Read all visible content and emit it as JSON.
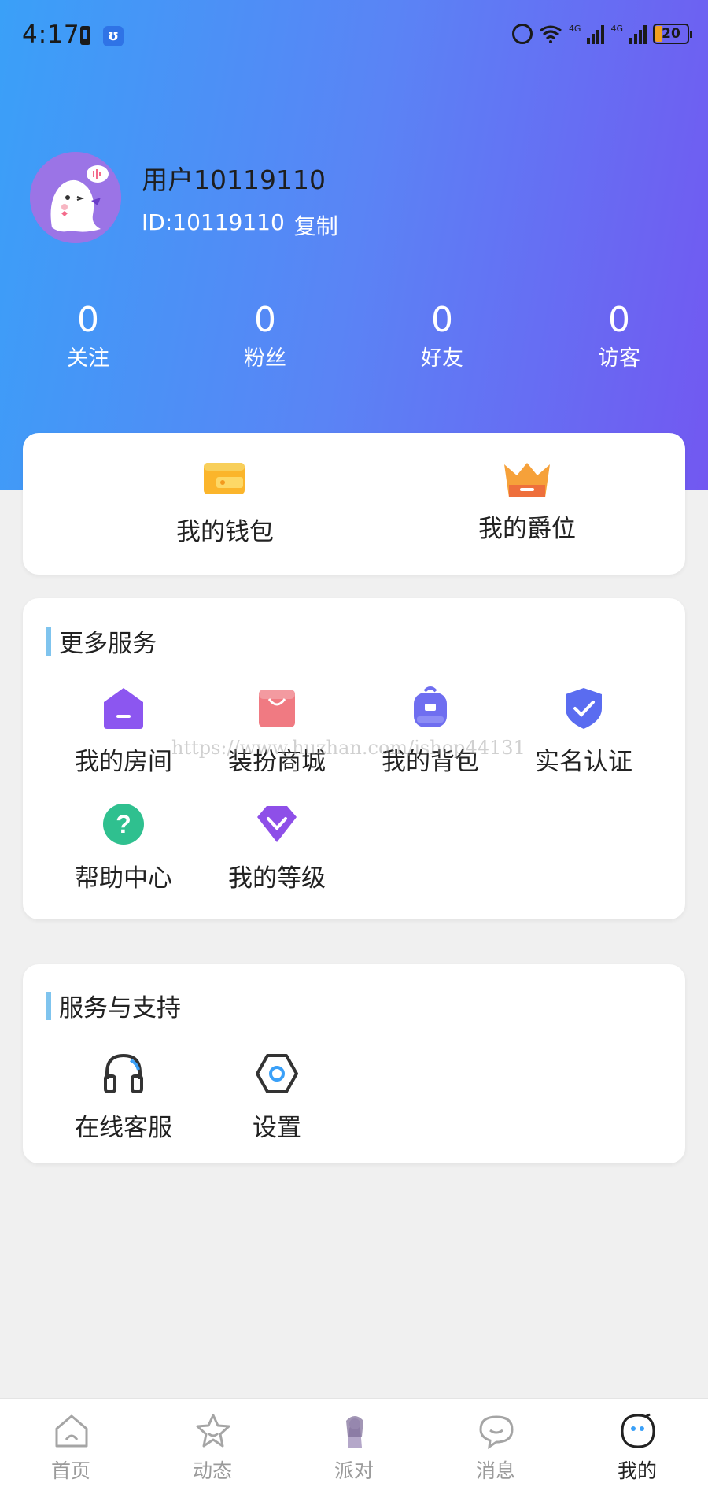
{
  "status_bar": {
    "time": "4:17",
    "battery": "20",
    "network_label": "4G"
  },
  "profile": {
    "username": "用户10119110",
    "id_text": "ID:10119110",
    "copy_label": "复制"
  },
  "stats": [
    {
      "value": "0",
      "label": "关注"
    },
    {
      "value": "0",
      "label": "粉丝"
    },
    {
      "value": "0",
      "label": "好友"
    },
    {
      "value": "0",
      "label": "访客"
    }
  ],
  "quick": {
    "wallet": "我的钱包",
    "rank": "我的爵位"
  },
  "more_services": {
    "title": "更多服务",
    "items": [
      {
        "label": "我的房间",
        "icon": "house-icon",
        "color": "#8c56f0"
      },
      {
        "label": "装扮商城",
        "icon": "shopping-bag-icon",
        "color": "#f07a82"
      },
      {
        "label": "我的背包",
        "icon": "backpack-icon",
        "color": "#6f6ef0"
      },
      {
        "label": "实名认证",
        "icon": "shield-check-icon",
        "color": "#5a6cf0"
      },
      {
        "label": "帮助中心",
        "icon": "question-icon",
        "color": "#2fc08f"
      },
      {
        "label": "我的等级",
        "icon": "diamond-icon",
        "color": "#8e4fe8"
      }
    ]
  },
  "support": {
    "title": "服务与支持",
    "items": [
      {
        "label": "在线客服",
        "icon": "headset-icon"
      },
      {
        "label": "设置",
        "icon": "settings-hex-icon"
      }
    ]
  },
  "watermark": "https://www.huzhan.com/ishop44131",
  "nav": {
    "items": [
      {
        "label": "首页",
        "icon": "home-icon"
      },
      {
        "label": "动态",
        "icon": "star-icon"
      },
      {
        "label": "派对",
        "icon": "party-avatar-icon"
      },
      {
        "label": "消息",
        "icon": "chat-bubble-icon"
      },
      {
        "label": "我的",
        "icon": "face-icon"
      }
    ],
    "active": "我的"
  },
  "colors": {
    "gradient_start": "#3aa0f8",
    "gradient_end": "#7258f1",
    "section_bar": "#7fc4ee"
  }
}
